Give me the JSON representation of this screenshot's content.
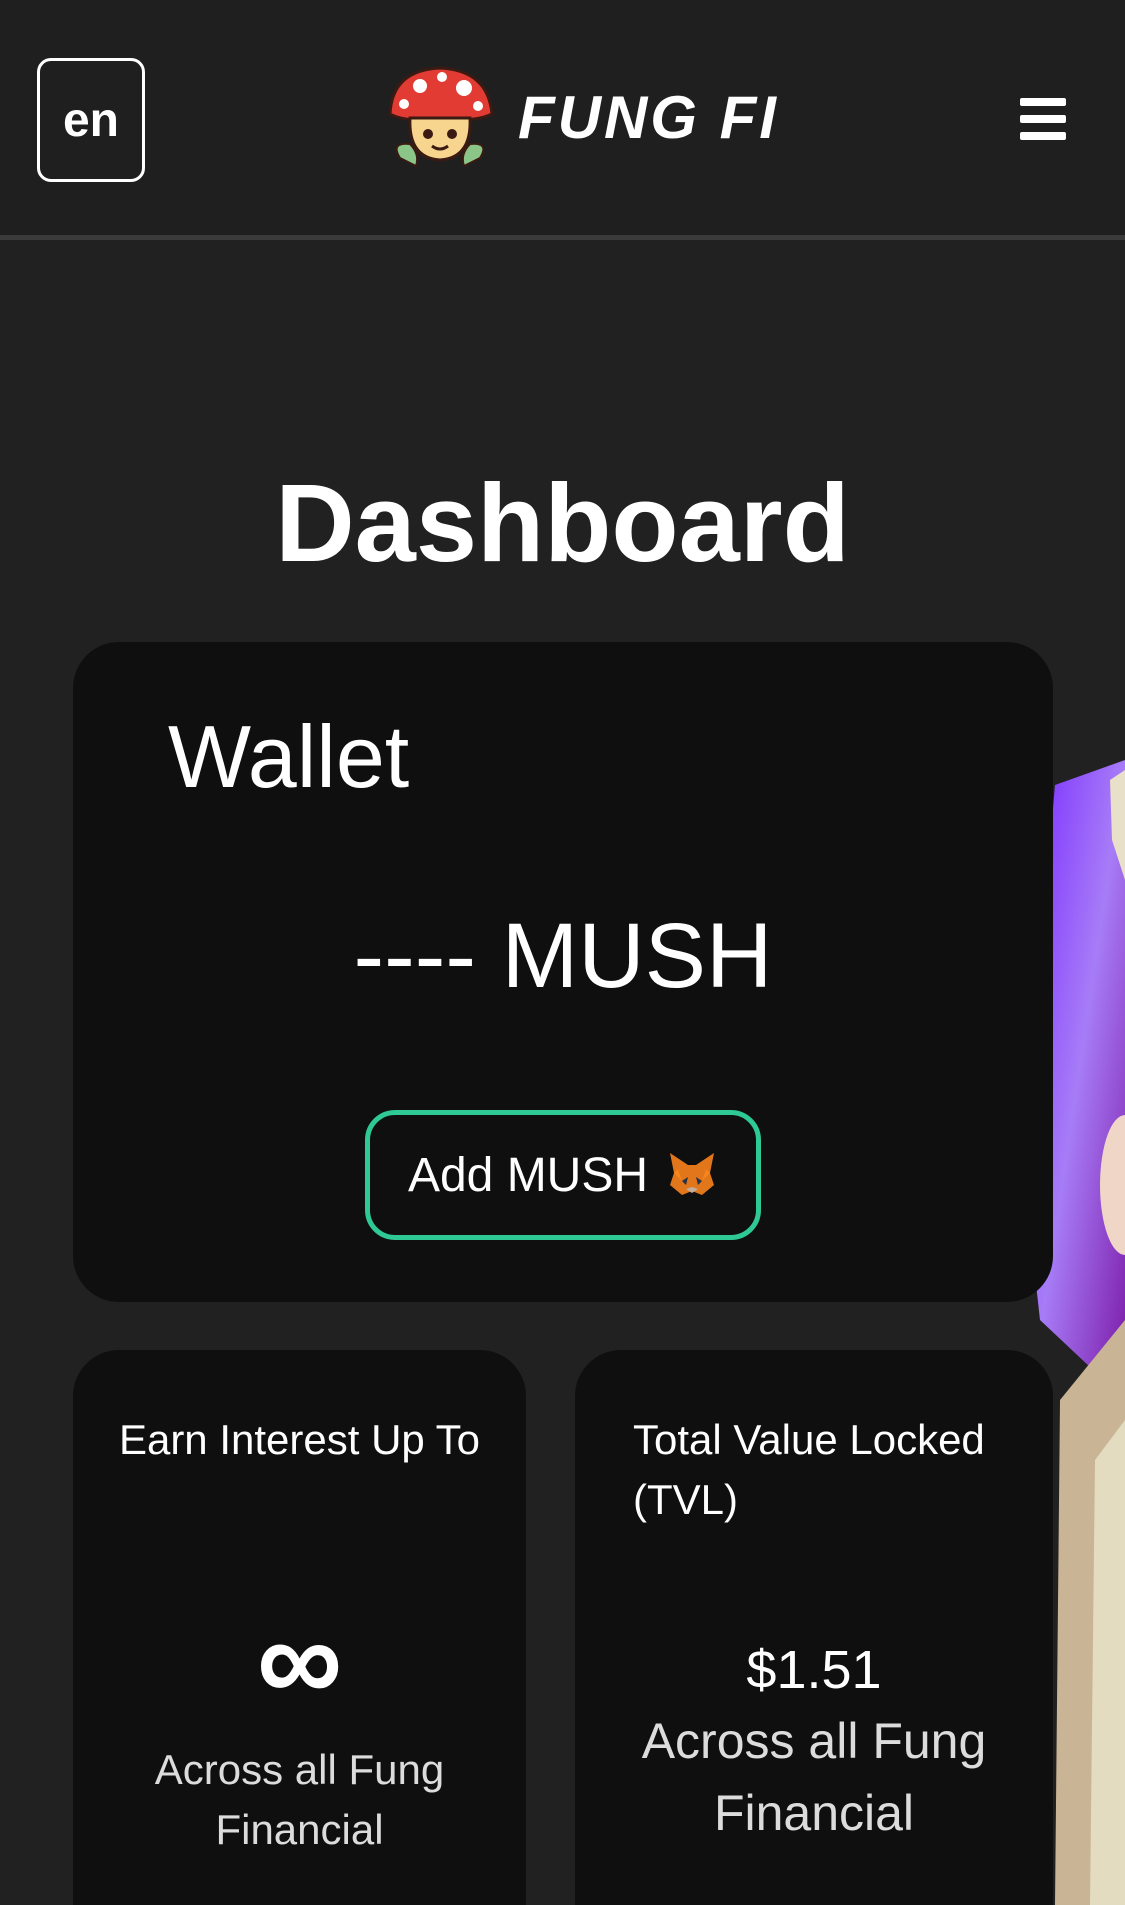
{
  "header": {
    "language": "en",
    "brand_name": "FUNG FI"
  },
  "main": {
    "title": "Dashboard"
  },
  "wallet": {
    "title": "Wallet",
    "balance": "---- MUSH",
    "add_button_label": "Add MUSH"
  },
  "stats": {
    "interest": {
      "label": "Earn Interest Up To",
      "value": "∞",
      "sub": "Across all Fung Financial"
    },
    "tvl": {
      "label": "Total Value Locked (TVL)",
      "value": "$1.51",
      "sub": "Across all Fung Financial"
    }
  },
  "colors": {
    "background": "#212121",
    "card": "#0f0f0f",
    "accent_border": "#2ec995",
    "text": "#ffffff"
  },
  "icons": {
    "logo": "mushroom-mascot-icon",
    "menu": "hamburger-menu-icon",
    "wallet_provider": "metamask-fox-icon"
  }
}
